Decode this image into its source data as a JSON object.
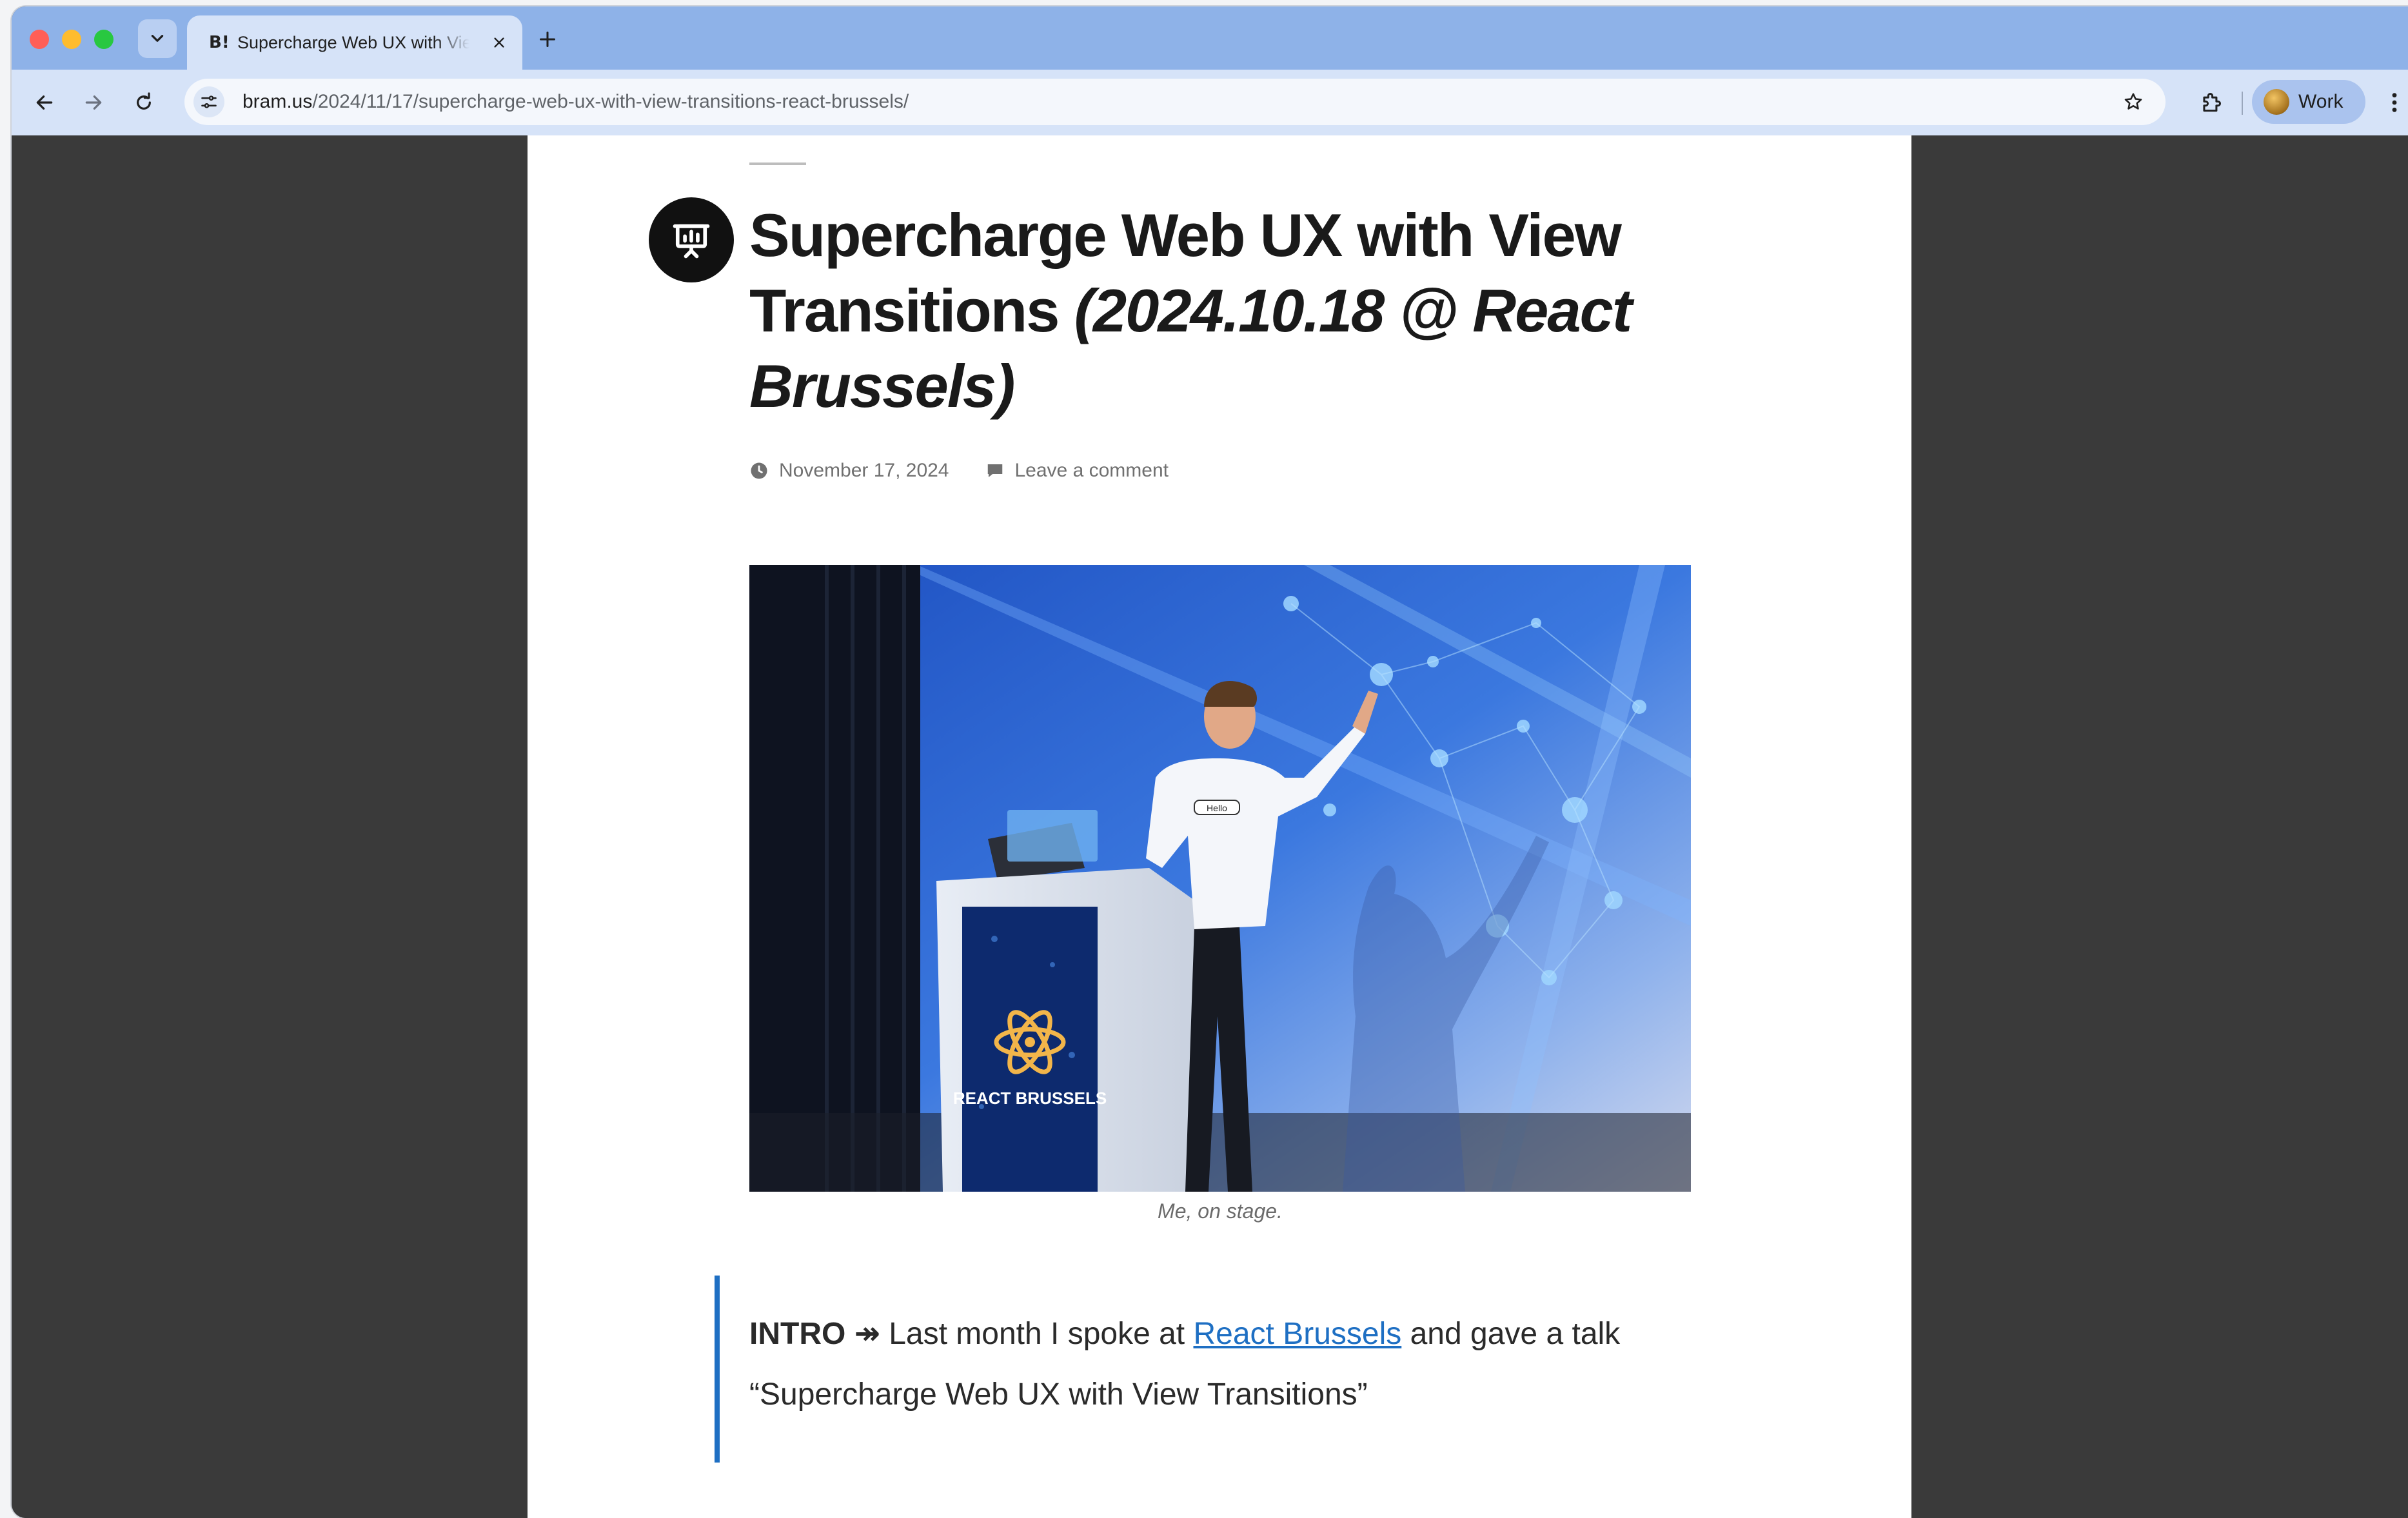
{
  "browser": {
    "tab": {
      "title": "Supercharge Web UX with View Transitions (2024.10.18 @ React Brussels)",
      "favicon": "B!"
    },
    "address_bar": {
      "host": "bram.us",
      "path": "/2024/11/17/supercharge-web-ux-with-view-transitions-react-brussels/"
    },
    "profile": {
      "label": "Work"
    },
    "icons": {
      "tab_search": "chevron-down-icon",
      "tab_close": "close-icon",
      "new_tab": "plus-icon",
      "back": "arrow-left-icon",
      "forward": "arrow-right-icon",
      "reload": "reload-icon",
      "site_info": "tune-icon",
      "bookmark": "star-icon",
      "extensions": "puzzle-icon",
      "menu": "more-vert-icon"
    }
  },
  "article": {
    "title_main": "Supercharge Web UX with View Transitions ",
    "title_italic": "(2024.10.18 @ React Brussels)",
    "post_format_icon": "presentation-icon",
    "date": "November 17, 2024",
    "comment_link": "Leave a comment",
    "image": {
      "caption": "Me, on stage.",
      "podium_text": "REACT BRUSSELS",
      "shirt_text": "Hello"
    },
    "intro": {
      "label": "INTRO ↠",
      "text_before": " Last month I spoke at ",
      "link": "React Brussels",
      "text_after": " and gave a talk “Supercharge Web UX with View Transitions”"
    }
  },
  "colors": {
    "tab_strip": "#8eb2e8",
    "toolbar": "#d6e3f8",
    "link": "#1e6fc3",
    "page_background": "#3a3a3a"
  }
}
